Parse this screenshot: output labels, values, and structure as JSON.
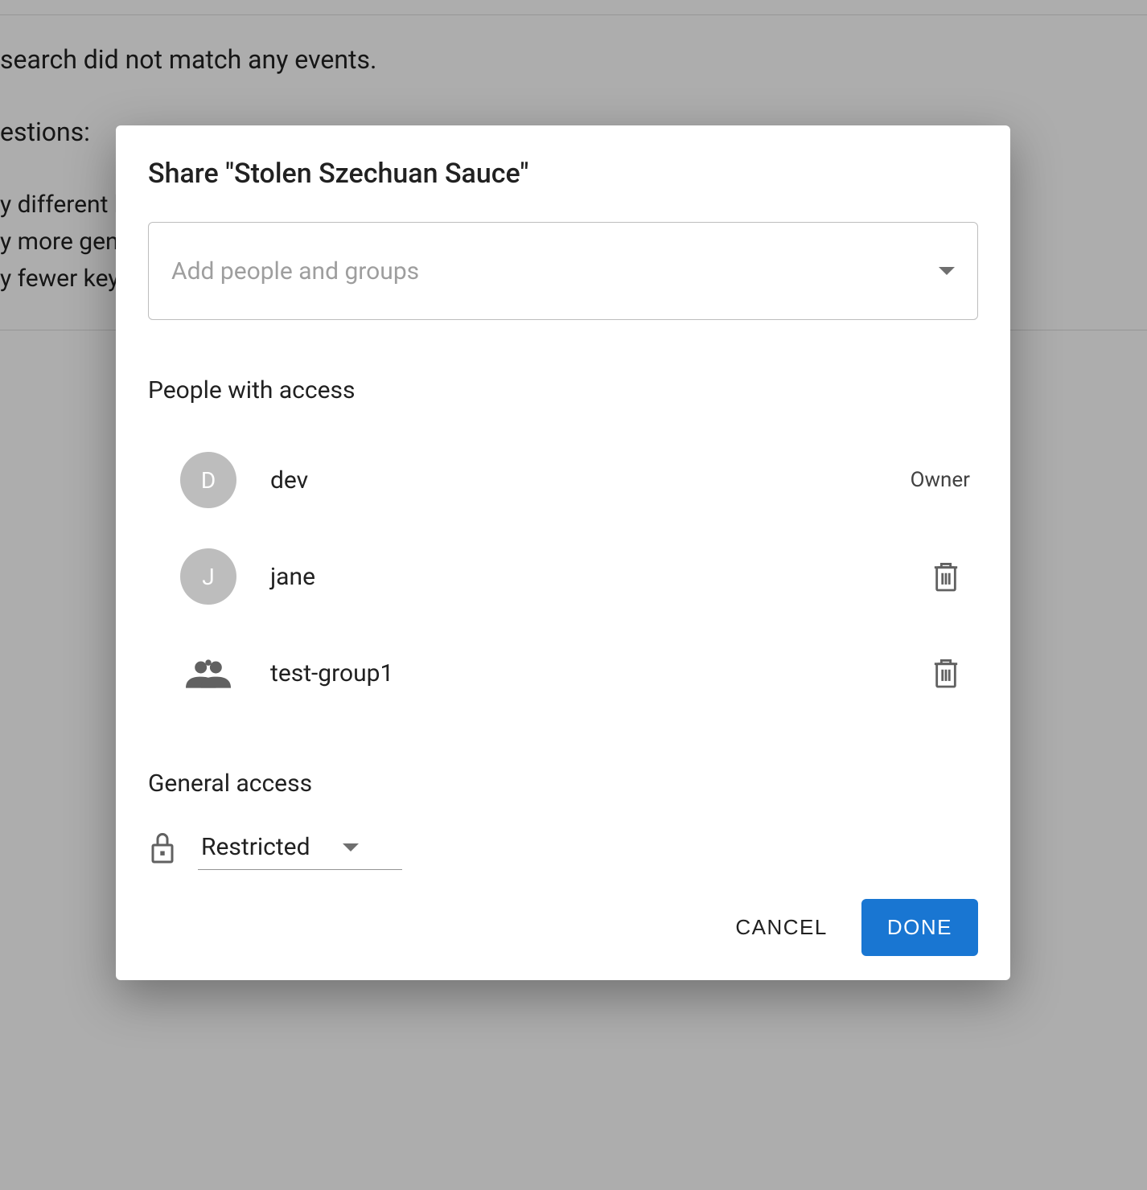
{
  "background": {
    "line1": "search did not match any events.",
    "line2": "estions:",
    "bullet1": "y different keywords.",
    "bullet2": "y more general keywords.",
    "bullet3": "y fewer keywords."
  },
  "dialog": {
    "title": "Share \"Stolen Szechuan Sauce\"",
    "add_placeholder": "Add people and groups",
    "people_label": "People with access",
    "people": [
      {
        "type": "user",
        "initial": "D",
        "name": "dev",
        "role": "Owner"
      },
      {
        "type": "user",
        "initial": "J",
        "name": "jane",
        "role": ""
      },
      {
        "type": "group",
        "initial": "",
        "name": "test-group1",
        "role": ""
      }
    ],
    "general_label": "General access",
    "general_value": "Restricted",
    "cancel_label": "CANCEL",
    "done_label": "DONE"
  }
}
